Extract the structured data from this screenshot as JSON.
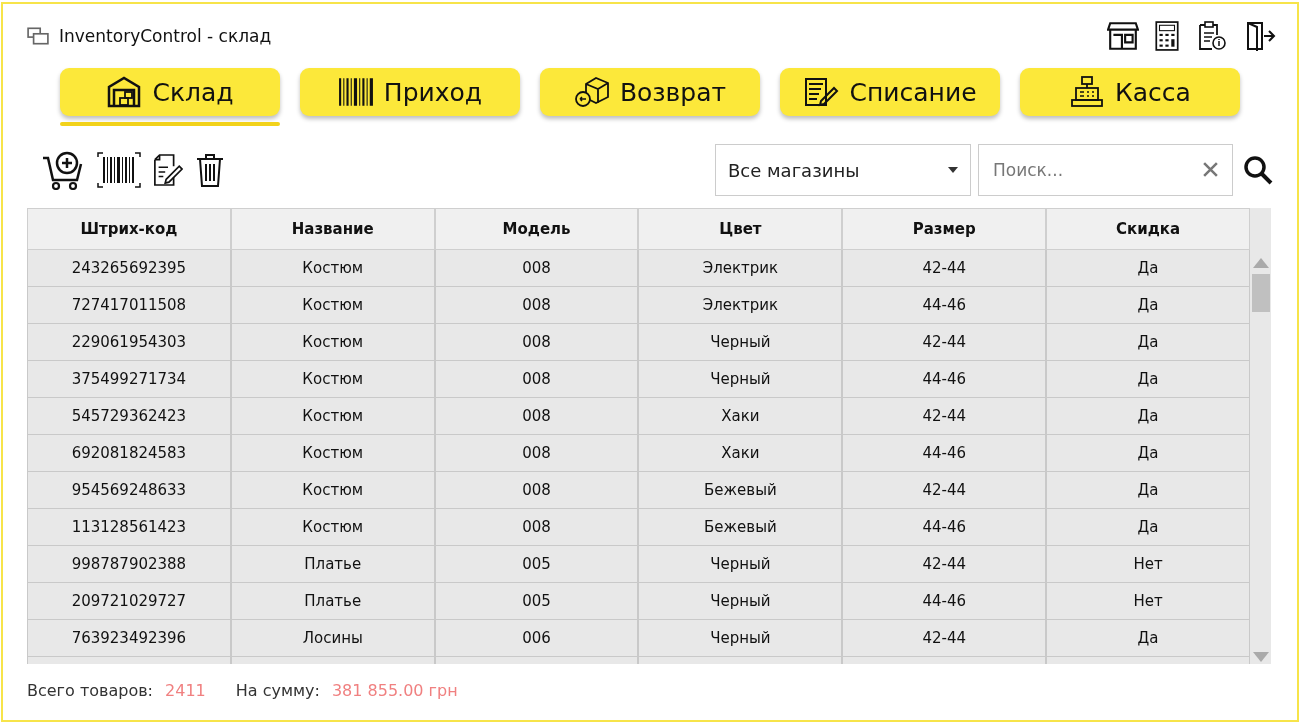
{
  "window": {
    "title": "InventoryControl - склад"
  },
  "tabs": [
    {
      "label": "Склад",
      "selected": true
    },
    {
      "label": "Приход",
      "selected": false
    },
    {
      "label": "Возврат",
      "selected": false
    },
    {
      "label": "Списание",
      "selected": false
    },
    {
      "label": "Касса",
      "selected": false
    }
  ],
  "store_filter": {
    "value": "Все магазины"
  },
  "search": {
    "placeholder": "Поиск..."
  },
  "table": {
    "columns": [
      "Штрих-код",
      "Название",
      "Модель",
      "Цвет",
      "Размер",
      "Скидка"
    ],
    "rows": [
      [
        "243265692395",
        "Костюм",
        "008",
        "Электрик",
        "42-44",
        "Да"
      ],
      [
        "727417011508",
        "Костюм",
        "008",
        "Электрик",
        "44-46",
        "Да"
      ],
      [
        "229061954303",
        "Костюм",
        "008",
        "Черный",
        "42-44",
        "Да"
      ],
      [
        "375499271734",
        "Костюм",
        "008",
        "Черный",
        "44-46",
        "Да"
      ],
      [
        "545729362423",
        "Костюм",
        "008",
        "Хаки",
        "42-44",
        "Да"
      ],
      [
        "692081824583",
        "Костюм",
        "008",
        "Хаки",
        "44-46",
        "Да"
      ],
      [
        "954569248633",
        "Костюм",
        "008",
        "Бежевый",
        "42-44",
        "Да"
      ],
      [
        "113128561423",
        "Костюм",
        "008",
        "Бежевый",
        "44-46",
        "Да"
      ],
      [
        "998787902388",
        "Платье",
        "005",
        "Черный",
        "42-44",
        "Нет"
      ],
      [
        "209721029727",
        "Платье",
        "005",
        "Черный",
        "44-46",
        "Нет"
      ],
      [
        "763923492396",
        "Лосины",
        "006",
        "Черный",
        "42-44",
        "Да"
      ]
    ]
  },
  "status_bar": {
    "total_label": "Всего товаров:",
    "total_value": "2411",
    "sum_label": "На сумму:",
    "sum_value": "381 855.00 грн"
  }
}
